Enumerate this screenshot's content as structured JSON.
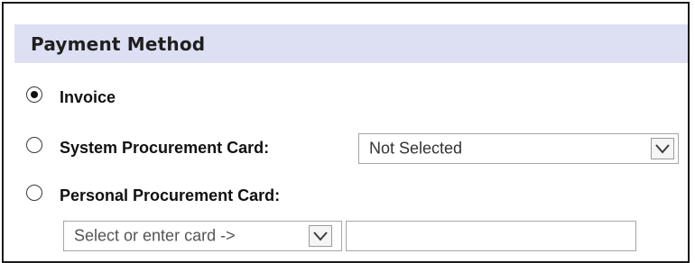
{
  "payment": {
    "title": "Payment Method",
    "options": [
      {
        "label": "Invoice",
        "selected": true
      },
      {
        "label": "System Procurement Card:",
        "selected": false
      },
      {
        "label": "Personal Procurement Card:",
        "selected": false
      }
    ],
    "system_card_select": {
      "value": "Not Selected",
      "icon": "chevron-down-icon"
    },
    "personal_card_select": {
      "value": "Select or enter card ->",
      "icon": "chevron-down-icon"
    },
    "personal_card_input": {
      "value": ""
    }
  },
  "colors": {
    "header_background": "#dde0f2",
    "border": "#1a1a1a",
    "text": "#111111"
  }
}
